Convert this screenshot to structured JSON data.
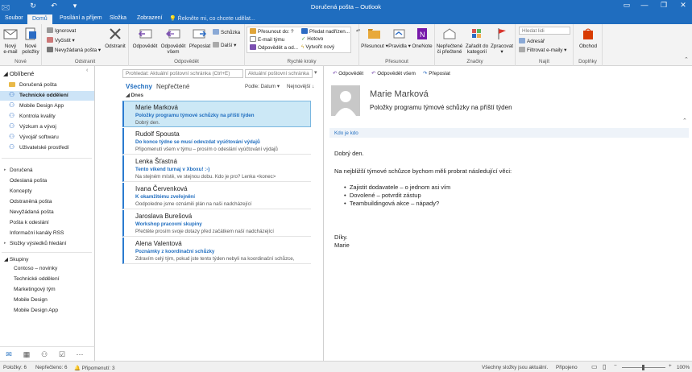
{
  "window": {
    "title": "Doručená pošta – Outlook",
    "minimize": "—",
    "restore": "❐",
    "close": "✕"
  },
  "quick_access": {
    "send_receive": "↻",
    "undo": "↶",
    "dropdown": "▾"
  },
  "tabs": [
    "Soubor",
    "Domů",
    "Posílání a příjem",
    "Složka",
    "Zobrazení"
  ],
  "tell_me": "💡 Řekněte mi, co chcete udělat...",
  "ribbon": {
    "new": {
      "new_email": "Nový\ne-mail",
      "new_items": "Nové\npoložky",
      "label": "Nové"
    },
    "delete": {
      "ignore": "Ignorovat",
      "clean": "Vyčistit",
      "junk": "Nevyžádaná pošta",
      "delete": "Odstranit",
      "label": "Odstranit"
    },
    "respond": {
      "reply": "Odpovědět",
      "reply_all": "Odpovědět\nvšem",
      "forward": "Přeposlat",
      "meeting": "Schůzka",
      "more": "Další",
      "label": "Odpovědět"
    },
    "quick_steps": {
      "items": [
        "Přesunout do: ?",
        "E-mail týmu",
        "Odpovědět a od...",
        "Předat nadřízen...",
        "Hotovo",
        "Vytvořit nový"
      ],
      "label": "Rychlé kroky"
    },
    "move": {
      "move": "Přesunout",
      "rules": "Pravidla",
      "onenote": "OneNote",
      "label": "Přesunout"
    },
    "tags": {
      "unread": "Nepřečtené\nči přečtené",
      "categorize": "Zařadit do\nkategorií",
      "followup": "Zpracovat",
      "label": "Značky"
    },
    "find": {
      "search_people": "Hledat lidi",
      "address_book": "Adresář",
      "filter": "Filtrovat e-maily",
      "label": "Najít"
    },
    "addins": {
      "store": "Obchod",
      "label": "Doplňky"
    }
  },
  "folders": {
    "favorites_header": "◢ Oblíbené",
    "favorites": [
      "Doručená pošta",
      "Technické oddělení",
      "Mobile Design App",
      "Kontrola kvality",
      "Výzkum a vývoj",
      "Vývojář softwaru",
      "Uživatelské prostředí"
    ],
    "mailbox": [
      "Doručená",
      "Odeslaná pošta",
      "Koncepty",
      "Odstraněná pošta",
      "Nevyžádaná pošta",
      "Pošta k odeslání",
      "Informační kanály RSS",
      "Složky výsledků hledání"
    ],
    "groups_header": "◢ Skupiny",
    "groups": [
      "Contoso – novinky",
      "Technické oddělení",
      "Marketingový tým",
      "Mobile Design",
      "Mobile Design App"
    ]
  },
  "list": {
    "search_placeholder": "Prohledat: Aktuální poštovní schránka (Ctrl+E)",
    "scope": "Aktuální poštovní schránka",
    "tab_all": "Všechny",
    "tab_unread": "Nepřečtené",
    "sort": "Podle: Datum ▾",
    "order": "Nejnovější ↓",
    "group_today": "◢ Dnes",
    "messages": [
      {
        "from": "Marie Marková",
        "subject": "Položky programu týmové schůzky na příští týden",
        "preview": "Dobrý den."
      },
      {
        "from": "Rudolf Spousta",
        "subject": "Do konce týdne se musí odevzdat vyúčtování výdajů",
        "preview": "Připomenutí všem v týmu – prosím o odeslání vyúčtování výdajů"
      },
      {
        "from": "Lenka Šťastná",
        "subject": "Tento víkend turnaj v Xboxu! :-)",
        "preview": "Na stejném místě, ve stejnou dobu. Kdo je pro? Lenka <konec>"
      },
      {
        "from": "Ivana Červenková",
        "subject": "K okamžitému zveřejnění",
        "preview": "Oodpoledne jsme oznámili plán na naši nadcházející"
      },
      {
        "from": "Jaroslava Burešová",
        "subject": "Workshop pracovní skupiny",
        "preview": "Přečtěte prosím svoje dotazy před začátkem naší nadcházející"
      },
      {
        "from": "Alena Valentová",
        "subject": "Poznámky z koordinační schůzky",
        "preview": "Zdravím celý tým, pokud jste tento týden nebyli na koordinační schůzce,"
      }
    ]
  },
  "reading": {
    "actions": [
      "Odpovědět",
      "Odpovědět všem",
      "Přeposlat"
    ],
    "sender": "Marie Marková",
    "subject": "Položky programu týmové schůzky na příští týden",
    "to_label": "Kdo je kdo",
    "greeting": "Dobrý den.",
    "intro": "Na nejbližší týmové schůzce bychom měli probrat následující věci:",
    "bullets": [
      "Zajistit dodavatele – o jednom asi vím",
      "Dovolené – potvrdit zástup",
      "Teambuildingová akce – nápady?"
    ],
    "closing": "Díky.",
    "signature": "Marie"
  },
  "status": {
    "items": "Položky: 6",
    "unread": "Nepřečteno: 6",
    "reminders": "🔔 Připomenutí: 3",
    "sync": "Všechny složky jsou aktuální.",
    "connected": "Připojeno",
    "zoom": "100%"
  }
}
